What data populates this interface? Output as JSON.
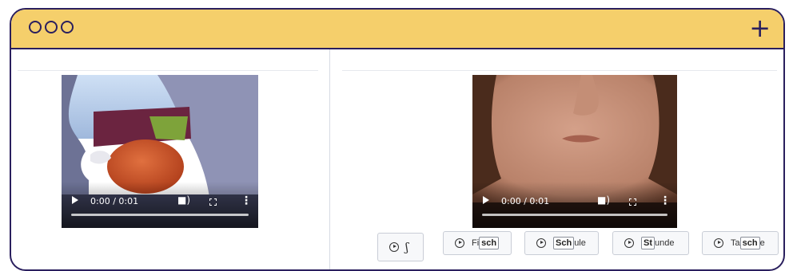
{
  "window": {
    "add_label": "+"
  },
  "left_video": {
    "time": "0:00 / 0:01"
  },
  "right_video": {
    "time": "0:00 / 0:01"
  },
  "sound_button": {
    "symbol": "ʃ"
  },
  "words": [
    {
      "pre": "Fi",
      "hl": "sch",
      "post": ""
    },
    {
      "pre": "",
      "hl": "Sch",
      "post": "ule"
    },
    {
      "pre": "",
      "hl": "St",
      "post": "unde"
    },
    {
      "pre": "Ta",
      "hl": "sch",
      "post": "e"
    }
  ],
  "colors": {
    "titlebar": "#f5cf6b",
    "frame": "#2a1f5e"
  }
}
